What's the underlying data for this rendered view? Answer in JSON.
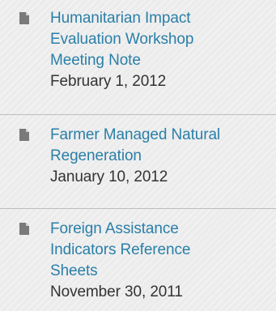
{
  "documents": [
    {
      "title_lines": [
        "Humanitarian Impact",
        "Evaluation Workshop",
        "Meeting Note"
      ],
      "date": "February 1, 2012",
      "icon": "document-icon"
    },
    {
      "title_lines": [
        "Farmer Managed Natural",
        "Regeneration"
      ],
      "date": "January 10, 2012",
      "icon": "document-icon"
    },
    {
      "title_lines": [
        "Foreign Assistance",
        "Indicators Reference",
        "Sheets"
      ],
      "date": "November 30, 2011",
      "icon": "document-icon"
    }
  ],
  "colors": {
    "link": "#2a7fa8",
    "date": "#333333",
    "icon": "#7a7a7a",
    "divider": "#bdbdbd",
    "background": "#ececec"
  }
}
